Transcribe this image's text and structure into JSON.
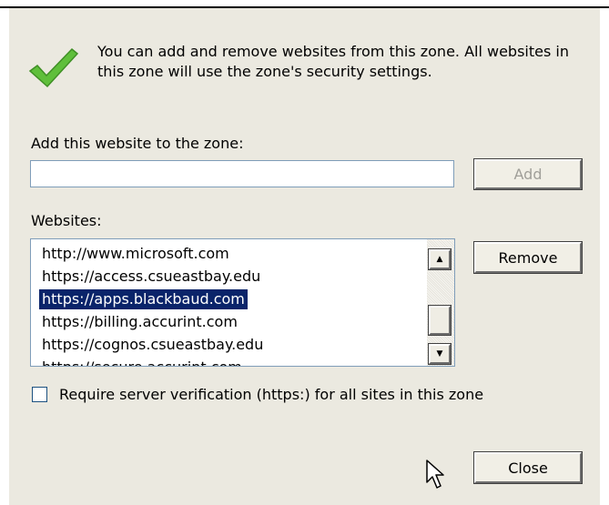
{
  "intro_text": "You can add and remove websites from this zone. All websites in this zone will use the zone's security settings.",
  "add_website": {
    "label": "Add this website to the zone:",
    "value": "",
    "add_button": "Add"
  },
  "websites": {
    "label": "Websites:",
    "items": [
      "http://www.microsoft.com",
      "https://access.csueastbay.edu",
      "https://apps.blackbaud.com",
      "https://billing.accurint.com",
      "https://cognos.csueastbay.edu",
      "https://secure.accurint.com"
    ],
    "selected": "https://apps.blackbaud.com",
    "remove_button": "Remove"
  },
  "require_verification": {
    "label": "Require server verification (https:) for all sites in this zone",
    "checked": false
  },
  "close_button": "Close",
  "icons": {
    "check": "check-icon",
    "scroll_up": "arrow-up-icon",
    "scroll_down": "arrow-down-icon",
    "cursor": "cursor-icon"
  }
}
